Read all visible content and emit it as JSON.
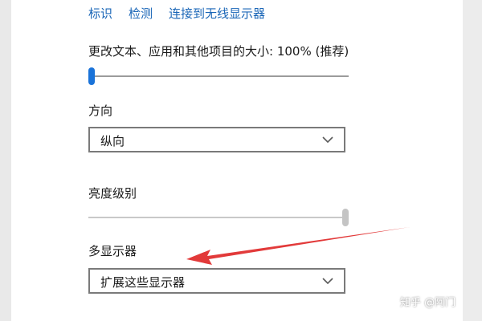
{
  "header_links": [
    "标识",
    "检测",
    "连接到无线显示器"
  ],
  "scale": {
    "label": "更改文本、应用和其他项目的大小: 100% (推荐)",
    "slider_value_fraction": 0.0
  },
  "orientation": {
    "label": "方向",
    "selected": "纵向"
  },
  "brightness": {
    "label": "亮度级别",
    "slider_value_fraction": 1.0
  },
  "multi_display": {
    "label": "多显示器",
    "selected": "扩展这些显示器"
  },
  "watermark": "知乎 @阿门",
  "colors": {
    "accent": "#1a73d9",
    "link": "#1a66b7",
    "annotation_arrow": "#e23a3a"
  }
}
